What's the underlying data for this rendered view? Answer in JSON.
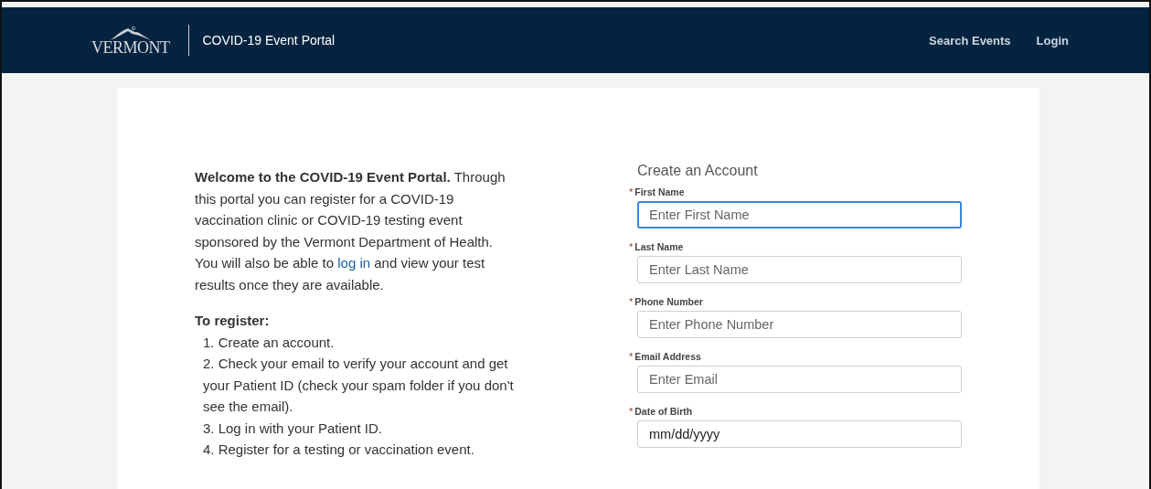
{
  "header": {
    "logo_text": "VERMONT",
    "title": "COVID-19 Event Portal",
    "nav": [
      "Search Events",
      "Login"
    ]
  },
  "intro": {
    "before": "**Welcome to the COVID-19 Event Portal.** Through this portal you can register for a COVID-19 vaccination clinic or COVID-19 testing event sponsored by the Vermont Department of Health. You will also be able to",
    "link": "log in",
    "after": "and view your test results once they are available."
  },
  "steps": {
    "heading": "To register:",
    "items": [
      "1. Create an account.",
      "2. Check your email to verify your account and get your Patient ID (check your spam folder if you don't see the email).",
      "3. Log in with your Patient ID.",
      "4. Register for a testing or vaccination event."
    ]
  },
  "form": {
    "title": "Create an Account",
    "fields": [
      {
        "label": "First Name",
        "required": "*",
        "placeholder": "Enter First Name",
        "focused": true,
        "kind": "text"
      },
      {
        "label": "Last Name",
        "required": "*",
        "placeholder": "Enter Last Name",
        "focused": false,
        "kind": "text"
      },
      {
        "label": "Phone Number",
        "required": "*",
        "placeholder": "Enter Phone Number",
        "focused": false,
        "kind": "text"
      },
      {
        "label": "Email Address",
        "required": "*",
        "placeholder": "Enter Email",
        "focused": false,
        "kind": "text"
      },
      {
        "label": "Date of Birth",
        "required": "*",
        "placeholder": "mm/dd/yyyy",
        "focused": false,
        "kind": "date"
      }
    ]
  }
}
